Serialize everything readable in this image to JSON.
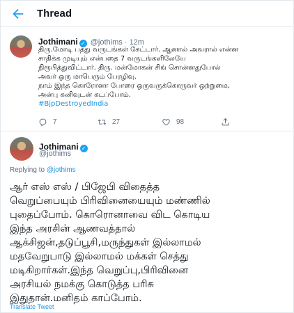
{
  "header": {
    "title": "Thread",
    "back_icon": "arrow-left-icon"
  },
  "tweet1": {
    "author_name": "Jothimani",
    "verified_icon": "verified-badge-icon",
    "handle": "@jothims",
    "separator": " · ",
    "time": "12m",
    "lines": [
      "திரு.மோடி பத்து வருடங்கள் கேட்டார். ஆனால் அவரால் என்ன",
      "சாதிக்க முடியும் என்பதை 7 வருடங்களிலேயே",
      "நிரூபித்துவிட்டார். திரு. மன்மோகன் சிங் சொன்னதுபோல்",
      "அவர் ஒரு மாபெரும் பேரழிவு.",
      "நாம் இந்த கொரோனா போரை ஒருவருக்கொருவர் ஒற்றுமை,",
      "அன்பு கனிவுடன் கடப்போம்."
    ],
    "hashtag": "#BjpDestroyedIndia",
    "reply_count": "7",
    "retweet_count": "27",
    "like_count": "98",
    "accent_color": "#1da1f2"
  },
  "tweet2": {
    "author_name": "Jothimani",
    "handle": "@jothims",
    "replying_prefix": "Replying to ",
    "replying_to": "@jothims",
    "lines": [
      "ஆர் எஸ் எஸ் / பிஜேபி விதைத்த",
      "வெறுப்பையும் பிரிவினையையும் மண்ணில்",
      "புதைப்போம். கொரொனாவை விட கொடிய",
      "இந்த அரசின் ஆணவத்தால்",
      "ஆக்சிஜன்,தடுப்பூசி,மருந்துகள் இல்லாமல்",
      "மதவேறுபாடு இல்லாமல் மக்கள் செத்து",
      "மடிகிறார்கள்.இந்த வெறுப்பு,பிரிவினை",
      "அரசியல் நமக்கு கொடுத்த பரிசு",
      "இதுதான்.மனிதம் காப்போம்."
    ],
    "translate_label": "Translate Tweet"
  }
}
